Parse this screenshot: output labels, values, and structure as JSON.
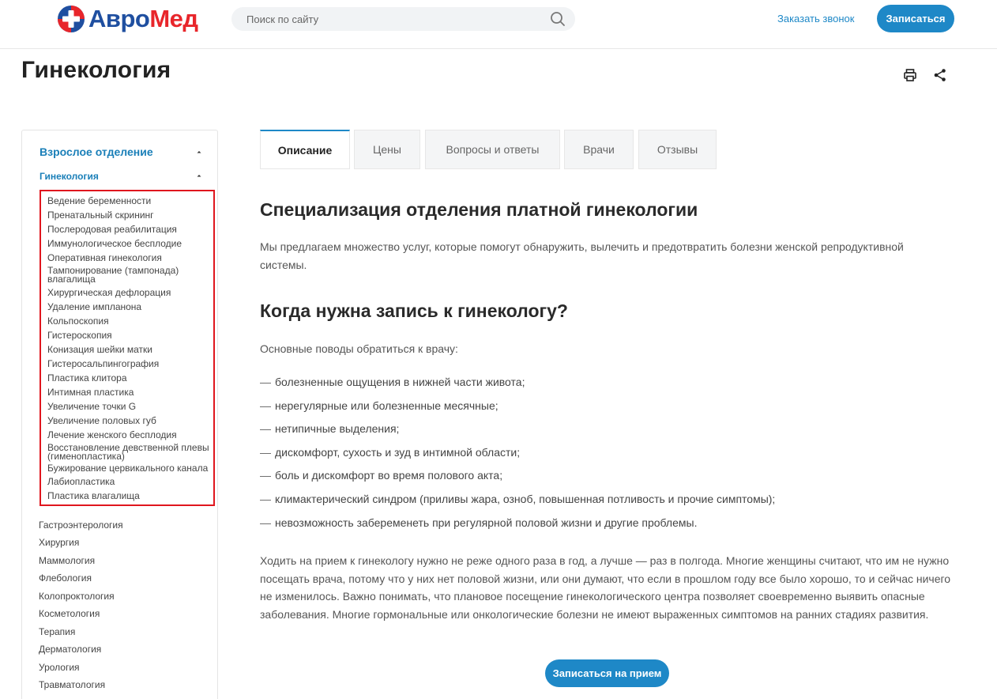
{
  "header": {
    "logo_part1": "Авро",
    "logo_part2": "Мед",
    "search_placeholder": "Поиск по сайту",
    "callback_label": "Заказать звонок",
    "signup_label": "Записаться"
  },
  "page": {
    "title": "Гинекология"
  },
  "sidebar": {
    "section_label": "Взрослое отделение",
    "subsection_label": "Гинекология",
    "highlighted_items": [
      "Ведение беременности",
      "Пренатальный скрининг",
      "Послеродовая реабилитация",
      "Иммунологическое бесплодие",
      "Оперативная гинекология",
      "Тампонирование (тампонада) влагалища",
      "Хирургическая дефлорация",
      "Удаление импланона",
      "Кольпоскопия",
      "Гистероскопия",
      "Конизация шейки матки",
      "Гистеросальпингография",
      "Пластика клитора",
      "Интимная пластика",
      "Увеличение точки G",
      "Увеличение половых губ",
      "Лечение женского бесплодия",
      "Восстановление девственной плевы (гименопластика)",
      "Бужирование цервикального канала",
      "Лабиопластика",
      "Пластика влагалища"
    ],
    "other_items": [
      "Гастроэнтерология",
      "Хирургия",
      "Маммология",
      "Флебология",
      "Колопроктология",
      "Косметология",
      "Терапия",
      "Дерматология",
      "Урология",
      "Травматология"
    ]
  },
  "tabs": [
    "Описание",
    "Цены",
    "Вопросы и ответы",
    "Врачи",
    "Отзывы"
  ],
  "content": {
    "heading1": "Специализация отделения платной гинекологии",
    "para1": "Мы предлагаем множество услуг, которые помогут обнаружить, вылечить и предотвратить болезни женской репродуктивной системы.",
    "heading2": "Когда нужна запись к гинекологу?",
    "reasons_intro": "Основные поводы обратиться к врачу:",
    "reasons": [
      "болезненные ощущения в нижней части живота;",
      "нерегулярные или болезненные месячные;",
      "нетипичные выделения;",
      "дискомфорт, сухость и зуд в интимной области;",
      "боль и дискомфорт во время полового акта;",
      "климактерический синдром (приливы жара, озноб, повышенная потливость и прочие симптомы);",
      "невозможность забеременеть при регулярной половой жизни и другие проблемы."
    ],
    "bullet_dash": "—",
    "para2": "Ходить на прием к гинекологу нужно не реже одного раза в год, а лучше — раз в полгода. Многие женщины считают, что им не нужно посещать врача, потому что у них нет половой жизни, или они думают, что если в прошлом году все было хорошо, то и сейчас ничего не изменилось. Важно понимать, что плановое посещение гинекологического центра позволяет своевременно выявить опасные заболевания. Многие гормональные или онкологические болезни не имеют выраженных симптомов на ранних стадиях развития.",
    "cta_label": "Записаться на прием"
  },
  "colors": {
    "accent": "#1e88c7",
    "highlight_border": "#e0161e",
    "logo_blue": "#1f4fa0",
    "logo_red": "#e8262b"
  },
  "icons": [
    "logo-cross-icon",
    "search-icon",
    "print-icon",
    "share-icon",
    "caret-up-icon"
  ]
}
